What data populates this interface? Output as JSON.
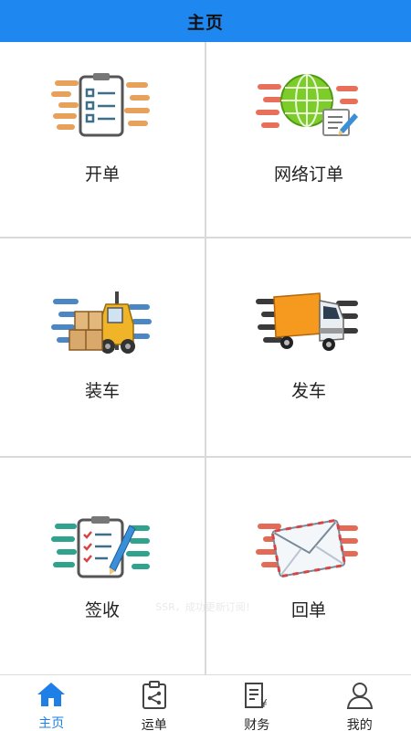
{
  "header": {
    "title": "主页"
  },
  "tiles": [
    {
      "label": "开单",
      "icon": "clipboard-checklist-icon"
    },
    {
      "label": "网络订单",
      "icon": "globe-order-icon"
    },
    {
      "label": "装车",
      "icon": "forklift-icon"
    },
    {
      "label": "发车",
      "icon": "truck-icon"
    },
    {
      "label": "签收",
      "icon": "sign-checklist-icon"
    },
    {
      "label": "回单",
      "icon": "envelope-icon"
    }
  ],
  "toast": {
    "text": "SSR，成功更新订阅！"
  },
  "tabbar": {
    "items": [
      {
        "label": "主页",
        "icon": "home-icon",
        "active": true
      },
      {
        "label": "运单",
        "icon": "waybill-icon",
        "active": false
      },
      {
        "label": "财务",
        "icon": "finance-icon",
        "active": false
      },
      {
        "label": "我的",
        "icon": "user-icon",
        "active": false
      }
    ]
  },
  "colors": {
    "header_bg": "#1e88f0",
    "active_tab": "#1e7fe6"
  }
}
